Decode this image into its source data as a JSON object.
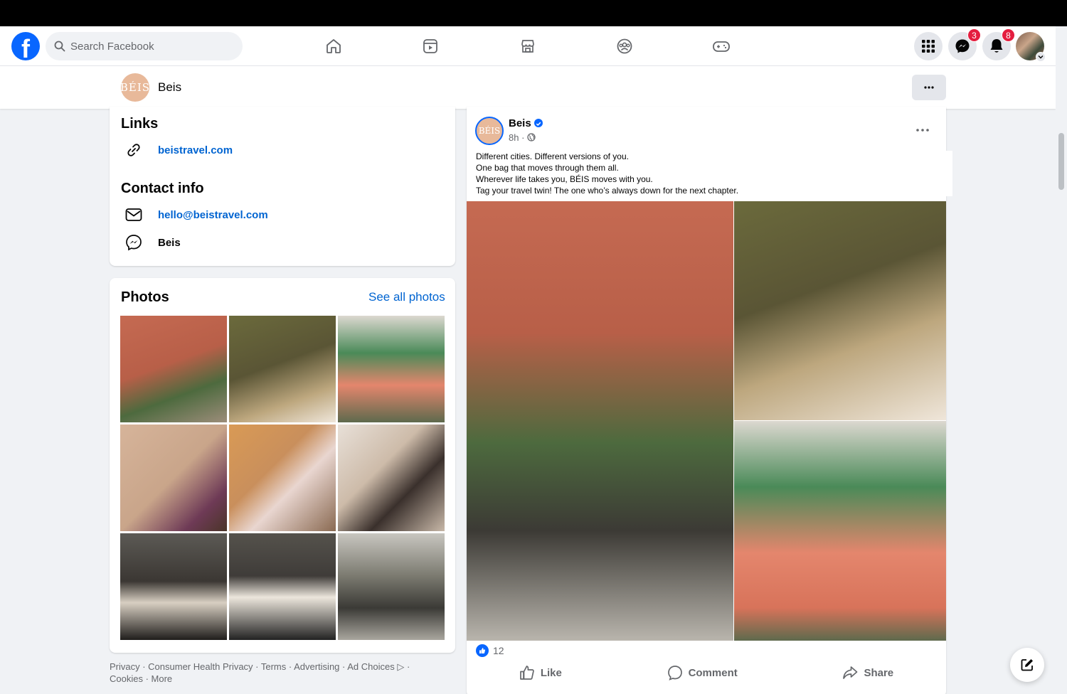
{
  "nav": {
    "logo_letter": "f",
    "search_placeholder": "Search Facebook",
    "messenger_badge": "3",
    "notifications_badge": "8"
  },
  "page_header": {
    "page_name": "Beis",
    "avatar_text": "BÉIS"
  },
  "intro": {
    "links_title": "Links",
    "website": "beistravel.com",
    "contact_title": "Contact info",
    "email": "hello@beistravel.com",
    "messenger_name": "Beis"
  },
  "photos": {
    "title": "Photos",
    "see_all": "See all photos",
    "thumbs": [
      "#b8614a",
      "#6d6a3f",
      "#e07f68",
      "#c49a7a",
      "#c98f5c",
      "#cdbba9",
      "#4d4b48",
      "#3f3c39",
      "#7b7a70"
    ]
  },
  "footer": {
    "text": "Privacy · Consumer Health Privacy · Terms · Advertising · Ad Choices ▷ · Cookies · More"
  },
  "post": {
    "author": "Beis",
    "avatar_text": "BÉIS",
    "time": "8h · ",
    "lines": [
      "Different cities. Different versions of you.",
      "One bag that moves through them all.",
      "Wherever life takes you, BÉIS moves with you.",
      "Tag your travel twin! The one who’s always down for the next chapter."
    ],
    "reaction_count": "12",
    "like_label": "Like",
    "comment_label": "Comment",
    "share_label": "Share"
  },
  "colors": {
    "brand_blue": "#0866ff",
    "link_blue": "#0064d1",
    "badge_red": "#e41e3f"
  }
}
